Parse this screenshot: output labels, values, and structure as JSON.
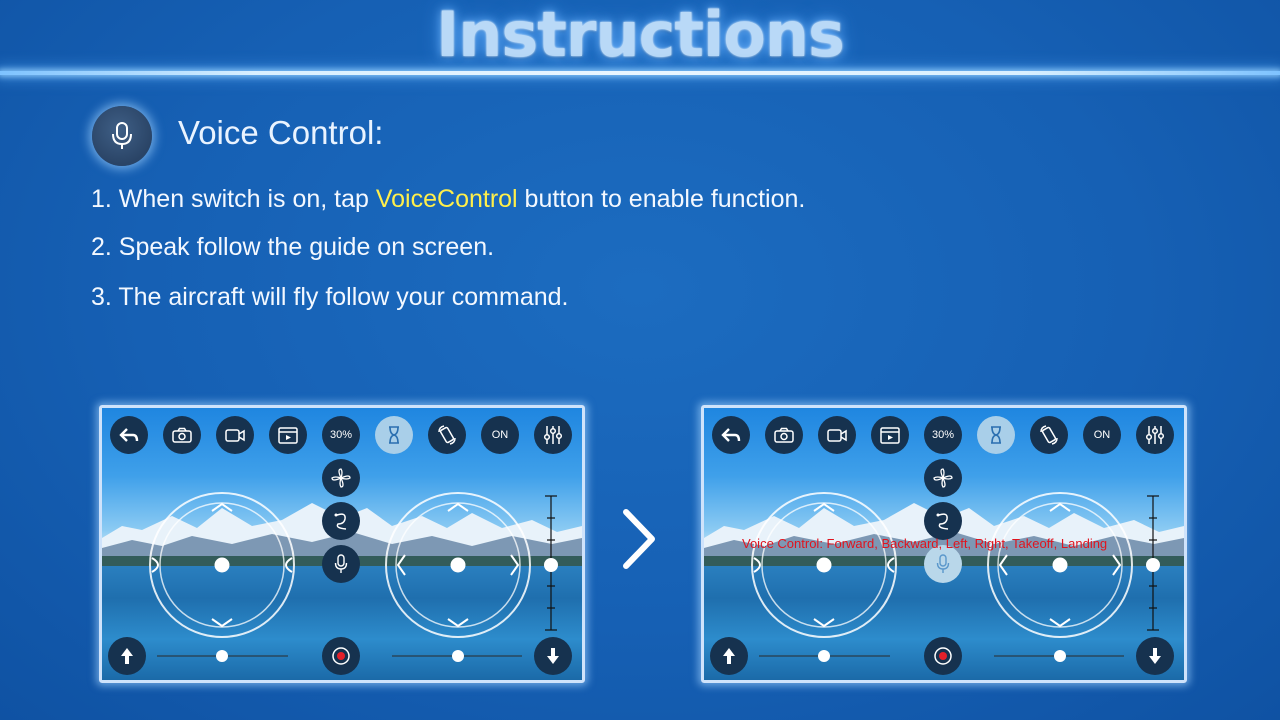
{
  "header": {
    "title": "Instructions"
  },
  "section": {
    "title": "Voice Control:",
    "icon": "microphone-icon",
    "steps": [
      {
        "before": "1. When switch is on, tap ",
        "highlight": "VoiceControl",
        "after": " button to enable function."
      },
      {
        "text": "2. Speak follow the guide on screen."
      },
      {
        "text": "3. The aircraft will fly follow your command."
      }
    ],
    "highlight_color": "#ffef4a"
  },
  "screens": {
    "toolbar_labels": {
      "speed": "30%",
      "switch": "ON"
    },
    "toolbar_icons": [
      "back-icon",
      "camera-icon",
      "video-icon",
      "album-icon",
      "speed-label",
      "hourglass-icon",
      "rotate-icon",
      "switch-label",
      "settings-icon"
    ],
    "voice_hint": "Voice Control: Forward, Backward, Left, Right, Takeoff, Landing",
    "hint_color": "#e0141e"
  },
  "colors": {
    "background": "#1660b4",
    "button": "#16324f",
    "active_button": "#a9cfe9"
  }
}
